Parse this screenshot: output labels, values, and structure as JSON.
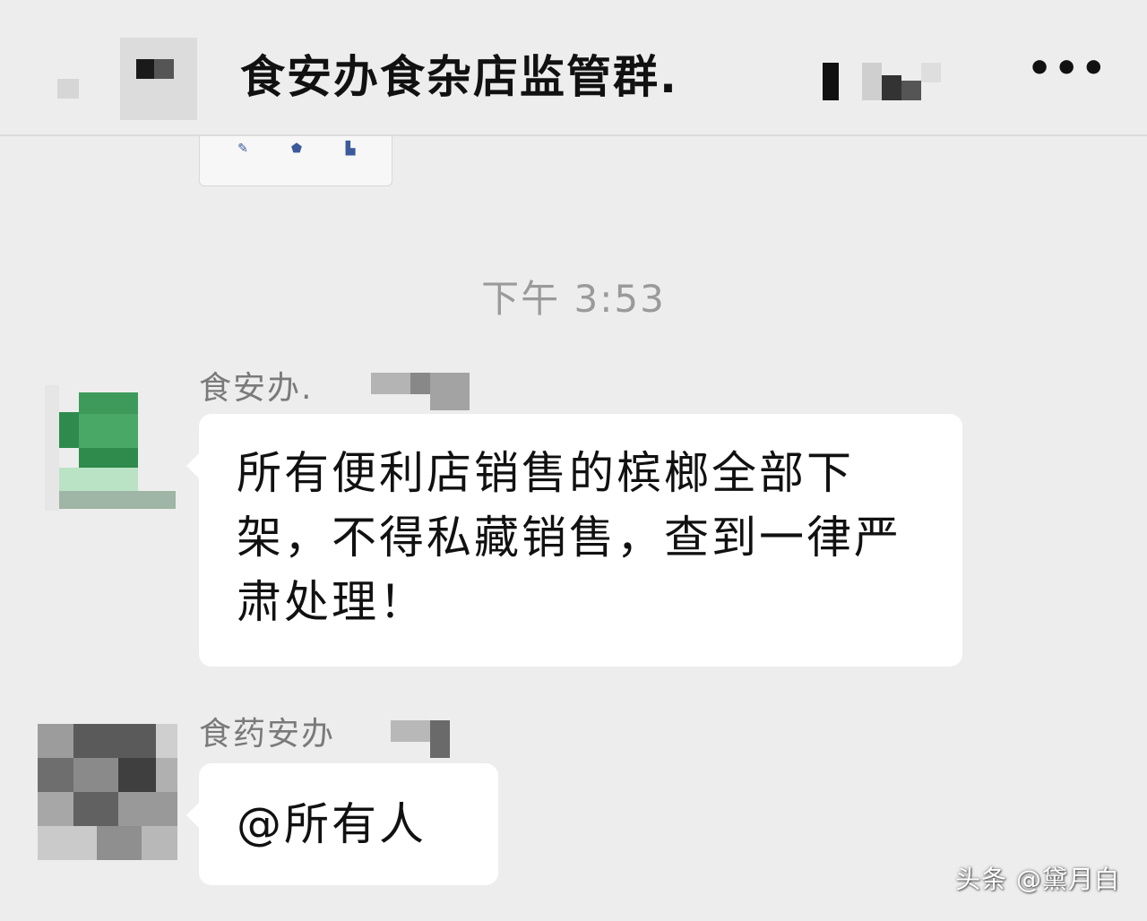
{
  "header": {
    "title": "食安办食杂店监管群.",
    "more_icon": "more-dots-icon",
    "more_label": "•••"
  },
  "toolbar": {
    "items": [
      {
        "icon": "pencil-icon",
        "glyph": "✎",
        "label": ""
      },
      {
        "icon": "shield-icon",
        "glyph": "⬟",
        "label": ""
      },
      {
        "icon": "document-icon",
        "glyph": "▙",
        "label": ""
      }
    ]
  },
  "timestamp": "下午 3:53",
  "messages": [
    {
      "sender": "食安办.",
      "text": "所有便利店销售的槟榔全部下架，不得私藏销售，查到一律严肃处理！"
    },
    {
      "sender": "食药安办",
      "text": "@所有人"
    }
  ],
  "watermark": "头条 @黛月白",
  "colors": {
    "background": "#ededed",
    "bubble": "#ffffff",
    "avatar_green": "#3d9a5a"
  }
}
